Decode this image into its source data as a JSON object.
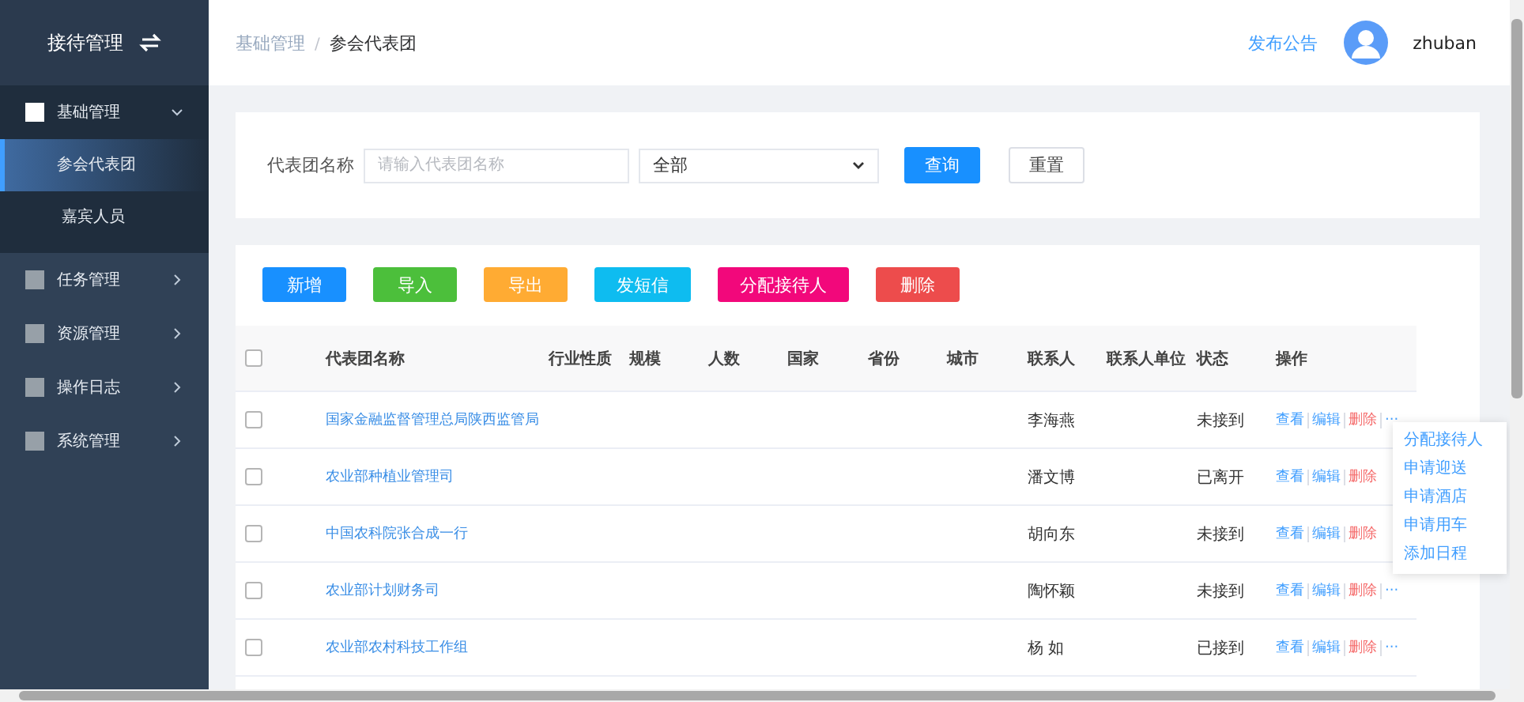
{
  "sidebar": {
    "title": "接待管理",
    "menu": [
      {
        "label": "基础管理",
        "expanded": true,
        "children": [
          {
            "label": "参会代表团",
            "selected": true
          },
          {
            "label": "嘉宾人员",
            "selected": false
          }
        ]
      },
      {
        "label": "任务管理",
        "expanded": false
      },
      {
        "label": "资源管理",
        "expanded": false
      },
      {
        "label": "操作日志",
        "expanded": false
      },
      {
        "label": "系统管理",
        "expanded": false
      }
    ]
  },
  "header": {
    "breadcrumb": [
      "基础管理",
      "参会代表团"
    ],
    "separator": "/",
    "link": "发布公告",
    "user": "zhuban"
  },
  "filter": {
    "label": "代表团名称",
    "placeholder": "请输入代表团名称",
    "select": "全部",
    "buttons": [
      {
        "label": "查询",
        "kind": "primary"
      },
      {
        "label": "重置",
        "kind": "default"
      }
    ]
  },
  "toolbar": [
    {
      "label": "新增",
      "color": "#1890ff"
    },
    {
      "label": "导入",
      "color": "#4cbf3b"
    },
    {
      "label": "导出",
      "color": "#ffab33"
    },
    {
      "label": "发短信",
      "color": "#0ebcf0"
    },
    {
      "label": "分配接待人",
      "color": "#f2087b"
    },
    {
      "label": "删除",
      "color": "#ed4c4c"
    }
  ],
  "table": {
    "checked": false,
    "columns": [
      "代表团名称",
      "行业性质",
      "规模",
      "人数",
      "国家",
      "省份",
      "城市",
      "联系人",
      "联系人单位",
      "状态",
      "操作"
    ],
    "rows": [
      {
        "checked": false,
        "name": "国家金融监督管理总局陕西监管局",
        "contact": "李海燕",
        "status": "未接到",
        "actions": [
          {
            "label": "查看",
            "kind": "link"
          },
          {
            "label": "编辑",
            "kind": "link"
          },
          {
            "label": "删除",
            "kind": "danger"
          },
          {
            "label": "···",
            "kind": "more"
          }
        ]
      },
      {
        "checked": false,
        "name": "农业部种植业管理司",
        "contact": "潘文博",
        "status": "已离开",
        "actions": [
          {
            "label": "查看",
            "kind": "link"
          },
          {
            "label": "编辑",
            "kind": "link"
          },
          {
            "label": "删除",
            "kind": "danger"
          }
        ]
      },
      {
        "checked": false,
        "name": "中国农科院张合成一行",
        "contact": "胡向东",
        "status": "未接到",
        "actions": [
          {
            "label": "查看",
            "kind": "link"
          },
          {
            "label": "编辑",
            "kind": "link"
          },
          {
            "label": "删除",
            "kind": "danger"
          }
        ]
      },
      {
        "checked": false,
        "name": "农业部计划财务司",
        "contact": "陶怀颖",
        "status": "未接到",
        "actions": [
          {
            "label": "查看",
            "kind": "link"
          },
          {
            "label": "编辑",
            "kind": "link"
          },
          {
            "label": "删除",
            "kind": "danger"
          },
          {
            "label": "···",
            "kind": "more"
          }
        ]
      },
      {
        "checked": false,
        "name": "农业部农村科技工作组",
        "contact": "杨 如",
        "status": "已接到",
        "actions": [
          {
            "label": "查看",
            "kind": "link"
          },
          {
            "label": "编辑",
            "kind": "link"
          },
          {
            "label": "删除",
            "kind": "danger"
          },
          {
            "label": "···",
            "kind": "more"
          }
        ]
      }
    ]
  },
  "dropdown": [
    "分配接待人",
    "申请迎送",
    "申请酒店",
    "申请用车",
    "添加日程"
  ]
}
